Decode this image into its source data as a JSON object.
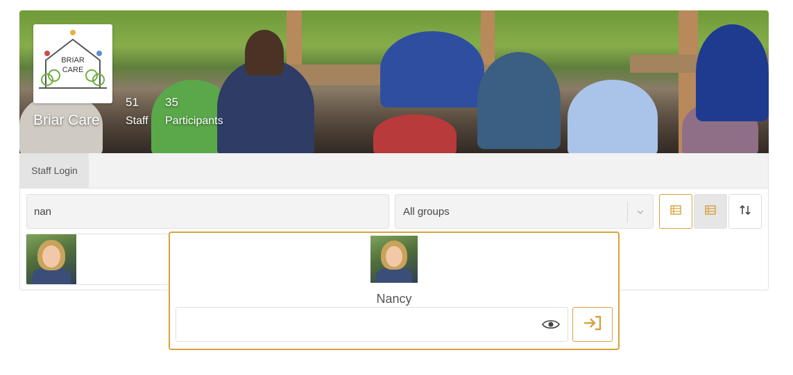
{
  "org": {
    "name": "Briar Care",
    "logo_text_line1": "BRIAR",
    "logo_text_line2": "CARE"
  },
  "stats": [
    {
      "value": "51",
      "label": "Staff"
    },
    {
      "value": "35",
      "label": "Participants"
    }
  ],
  "tabs": [
    {
      "label": "Staff Login"
    }
  ],
  "search": {
    "value": "nan"
  },
  "group_filter": {
    "selected": "All groups"
  },
  "view_buttons": [
    "list-view-icon",
    "grid-view-icon",
    "sort-icon"
  ],
  "popup": {
    "user_name": "Nancy",
    "password_value": "",
    "eye_icon": "eye-icon",
    "submit_icon": "sign-in-icon"
  },
  "colors": {
    "accent": "#d6a13a",
    "panel_bg": "#f3f3f3"
  }
}
